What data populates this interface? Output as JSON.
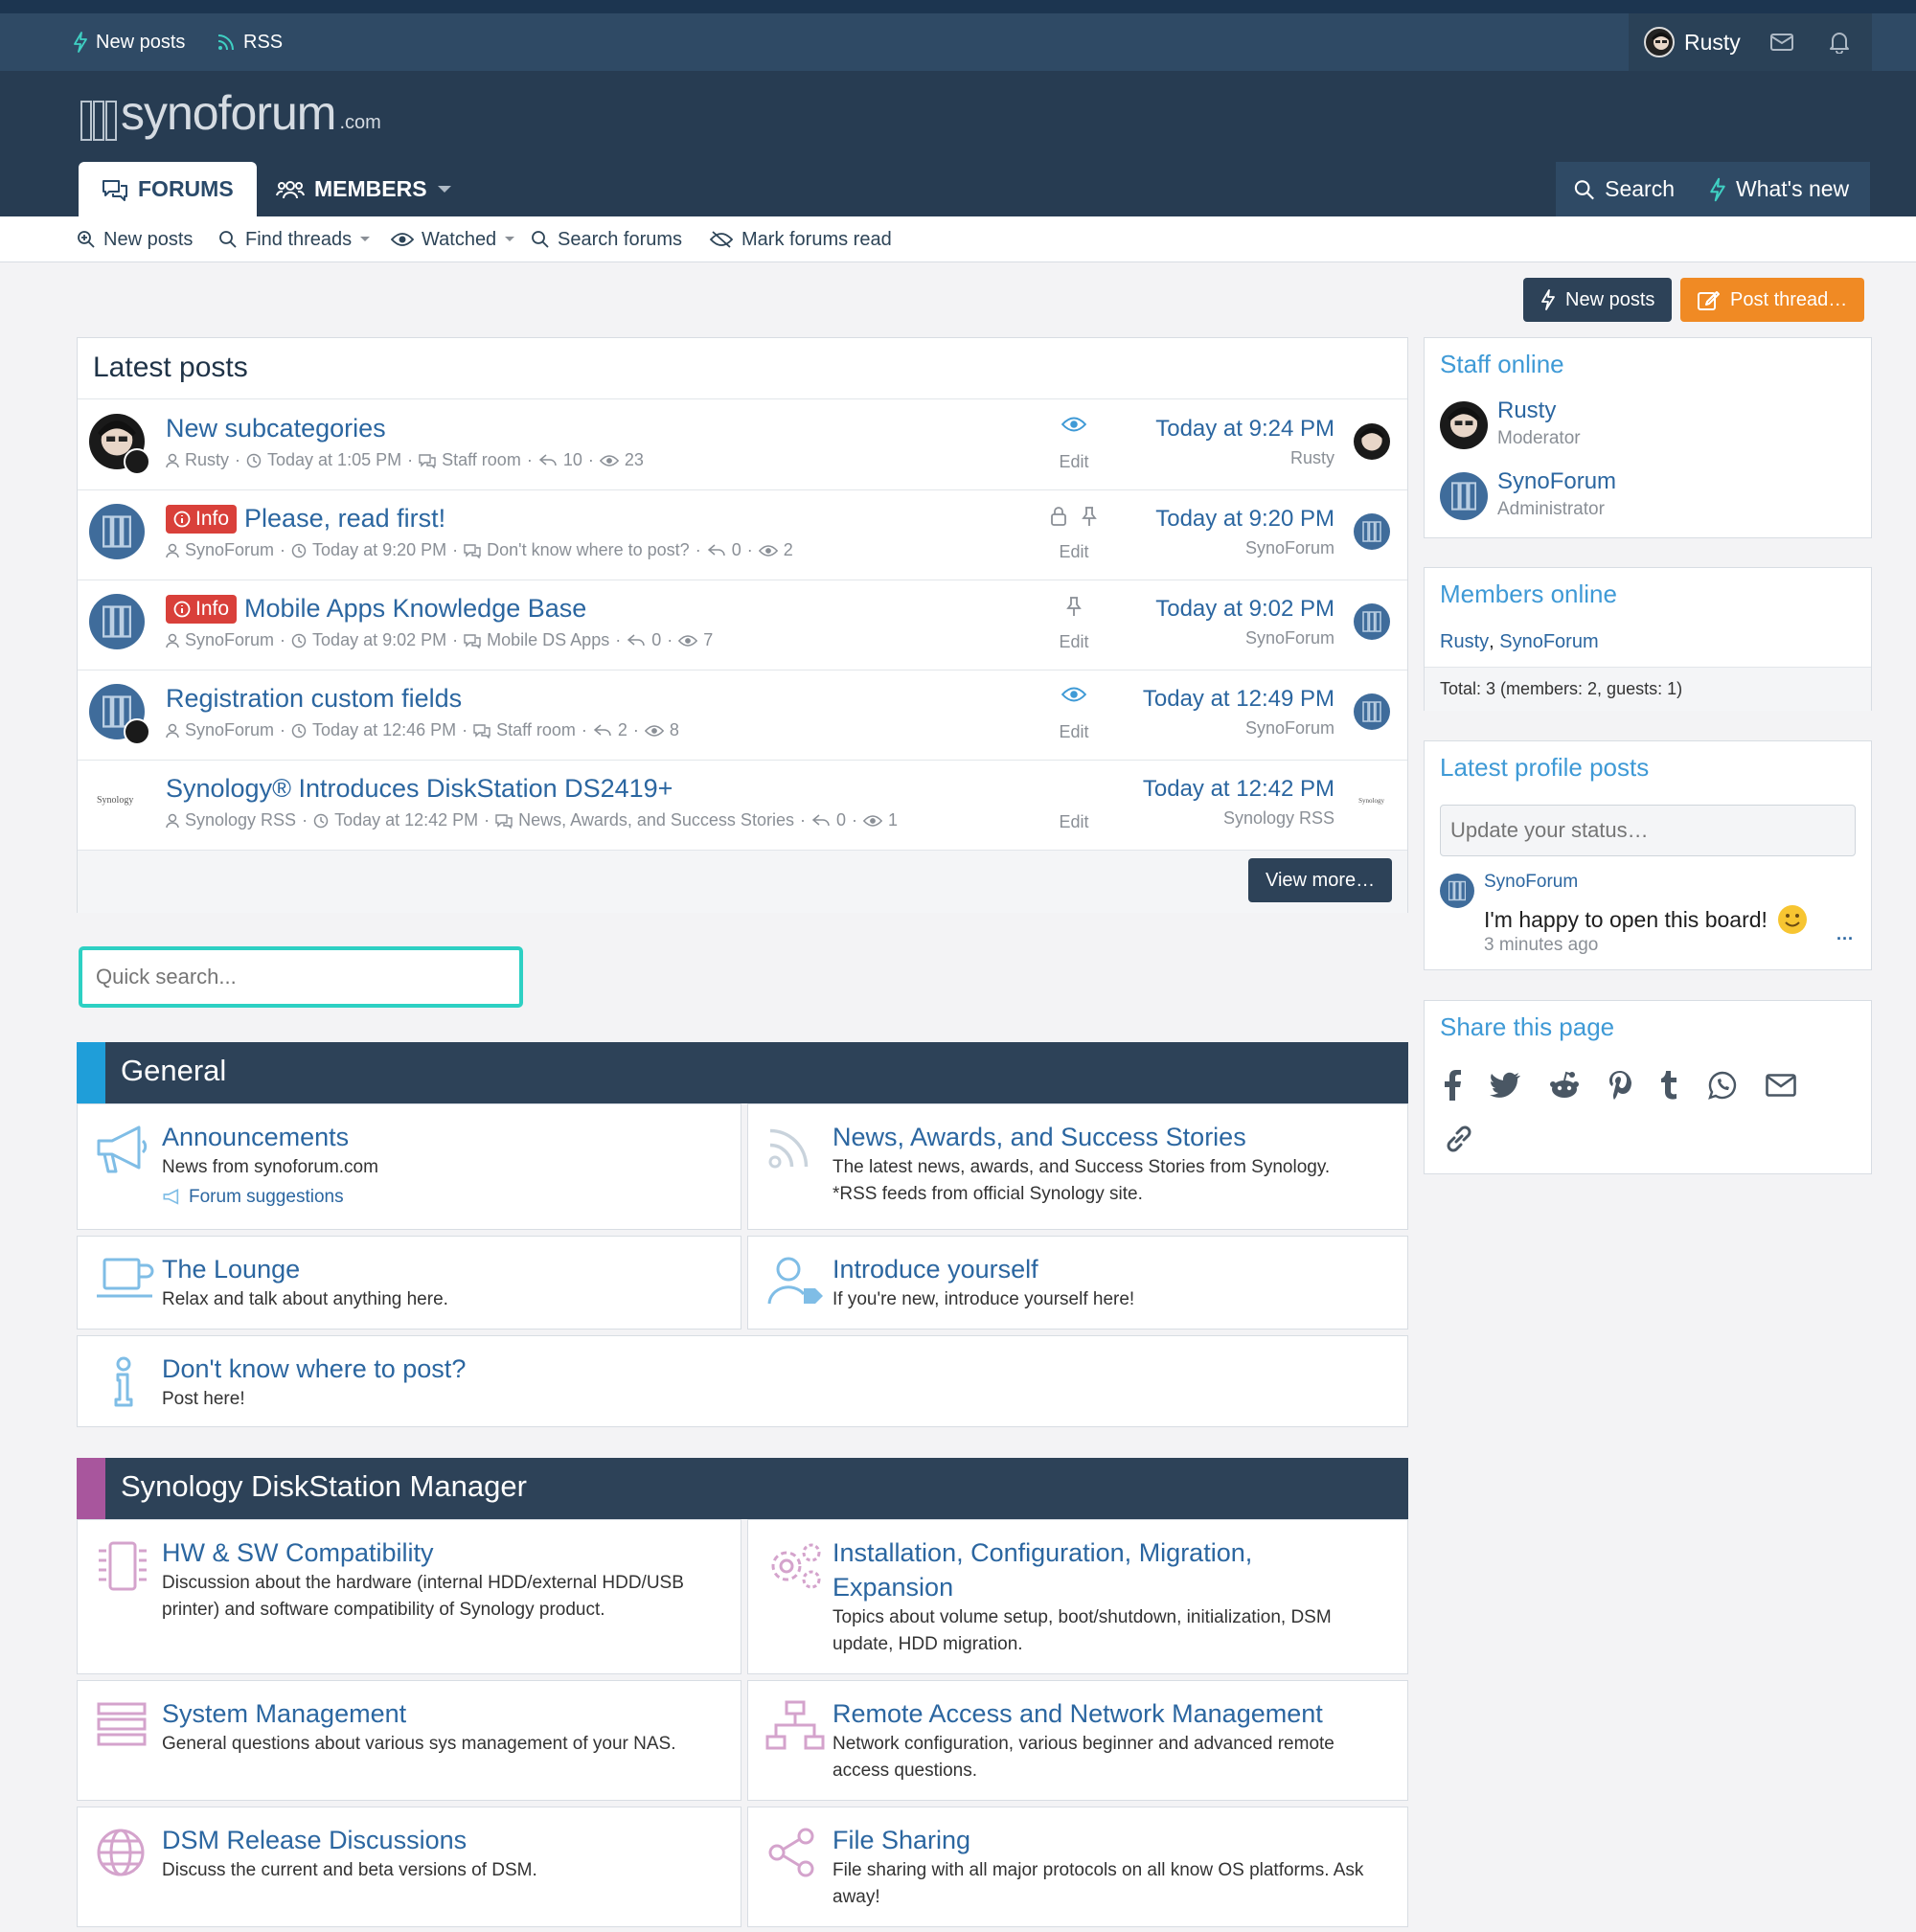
{
  "topbar": {
    "new_posts": "New posts",
    "rss": "RSS",
    "user": "Rusty"
  },
  "logo": {
    "name": "synoforum",
    "suffix": ".com"
  },
  "nav": {
    "forums": "FORUMS",
    "members": "MEMBERS",
    "search": "Search",
    "whats_new": "What's new"
  },
  "subnav": {
    "new_posts": "New posts",
    "find_threads": "Find threads",
    "watched": "Watched",
    "search_forums": "Search forums",
    "mark_read": "Mark forums read"
  },
  "actions": {
    "new_posts": "New posts",
    "post_thread": "Post thread…"
  },
  "latest": {
    "title": "Latest posts",
    "edit": "Edit",
    "view_more": "View more…",
    "rows": [
      {
        "badge": "",
        "title": "New subcategories",
        "author": "Rusty",
        "time": "Today at 1:05 PM",
        "forum": "Staff room",
        "replies": "10",
        "views": "23",
        "date": "Today at 9:24 PM",
        "last": "Rusty"
      },
      {
        "badge": "Info",
        "title": "Please, read first!",
        "author": "SynoForum",
        "time": "Today at 9:20 PM",
        "forum": "Don't know where to post?",
        "replies": "0",
        "views": "2",
        "date": "Today at 9:20 PM",
        "last": "SynoForum"
      },
      {
        "badge": "Info",
        "title": "Mobile Apps Knowledge Base",
        "author": "SynoForum",
        "time": "Today at 9:02 PM",
        "forum": "Mobile DS Apps",
        "replies": "0",
        "views": "7",
        "date": "Today at 9:02 PM",
        "last": "SynoForum"
      },
      {
        "badge": "",
        "title": "Registration custom fields",
        "author": "SynoForum",
        "time": "Today at 12:46 PM",
        "forum": "Staff room",
        "replies": "2",
        "views": "8",
        "date": "Today at 12:49 PM",
        "last": "SynoForum"
      },
      {
        "badge": "",
        "title": "Synology® Introduces DiskStation DS2419+",
        "author": "Synology RSS",
        "time": "Today at 12:42 PM",
        "forum": "News, Awards, and Success Stories",
        "replies": "0",
        "views": "1",
        "date": "Today at 12:42 PM",
        "last": "Synology RSS"
      }
    ]
  },
  "quick_search": {
    "placeholder": "Quick search..."
  },
  "general": {
    "title": "General",
    "announcements": {
      "title": "Announcements",
      "desc": "News from synoforum.com",
      "sub": "Forum suggestions"
    },
    "news": {
      "title": "News, Awards, and Success Stories",
      "desc": "The latest news, awards, and Success Stories from Synology. *RSS feeds from official Synology site."
    },
    "lounge": {
      "title": "The Lounge",
      "desc": "Relax and talk about anything here."
    },
    "introduce": {
      "title": "Introduce yourself",
      "desc": "If you're new, introduce yourself here!"
    },
    "dontknow": {
      "title": "Don't know where to post?",
      "desc": "Post here!"
    }
  },
  "dsm": {
    "title": "Synology DiskStation Manager",
    "hw": {
      "title": "HW & SW Compatibility",
      "desc": "Discussion about the hardware (internal HDD/external HDD/USB printer) and software compatibility of Synology product."
    },
    "install": {
      "title": "Installation, Configuration, Migration, Expansion",
      "desc": "Topics about volume setup, boot/shutdown, initialization, DSM update, HDD migration."
    },
    "sysmgmt": {
      "title": "System Management",
      "desc": "General questions about various sys management of your NAS."
    },
    "remote": {
      "title": "Remote Access and Network Management",
      "desc": "Network configuration, various beginner and advanced remote access questions."
    },
    "release": {
      "title": "DSM Release Discussions",
      "desc": "Discuss the current and beta versions of DSM."
    },
    "filesharing": {
      "title": "File Sharing",
      "desc": "File sharing with all major protocols on all know OS platforms. Ask away!"
    }
  },
  "sidebar": {
    "staff": {
      "title": "Staff online",
      "members": [
        {
          "name": "Rusty",
          "role": "Moderator"
        },
        {
          "name": "SynoForum",
          "role": "Administrator"
        }
      ]
    },
    "members_online": {
      "title": "Members online",
      "user1": "Rusty",
      "sep": ",",
      "user2": "SynoForum",
      "total": "Total: 3 (members: 2, guests: 1)"
    },
    "profile_posts": {
      "title": "Latest profile posts",
      "placeholder": "Update your status…",
      "author": "SynoForum",
      "text": "I'm happy to open this board!",
      "time": "3 minutes ago",
      "more": "···"
    },
    "share": {
      "title": "Share this page"
    }
  },
  "colors": {
    "accent": "#3f9ad6",
    "link": "#2b66a0",
    "header": "#273c52",
    "orange": "#f08a24",
    "teal": "#2dd0c3"
  }
}
